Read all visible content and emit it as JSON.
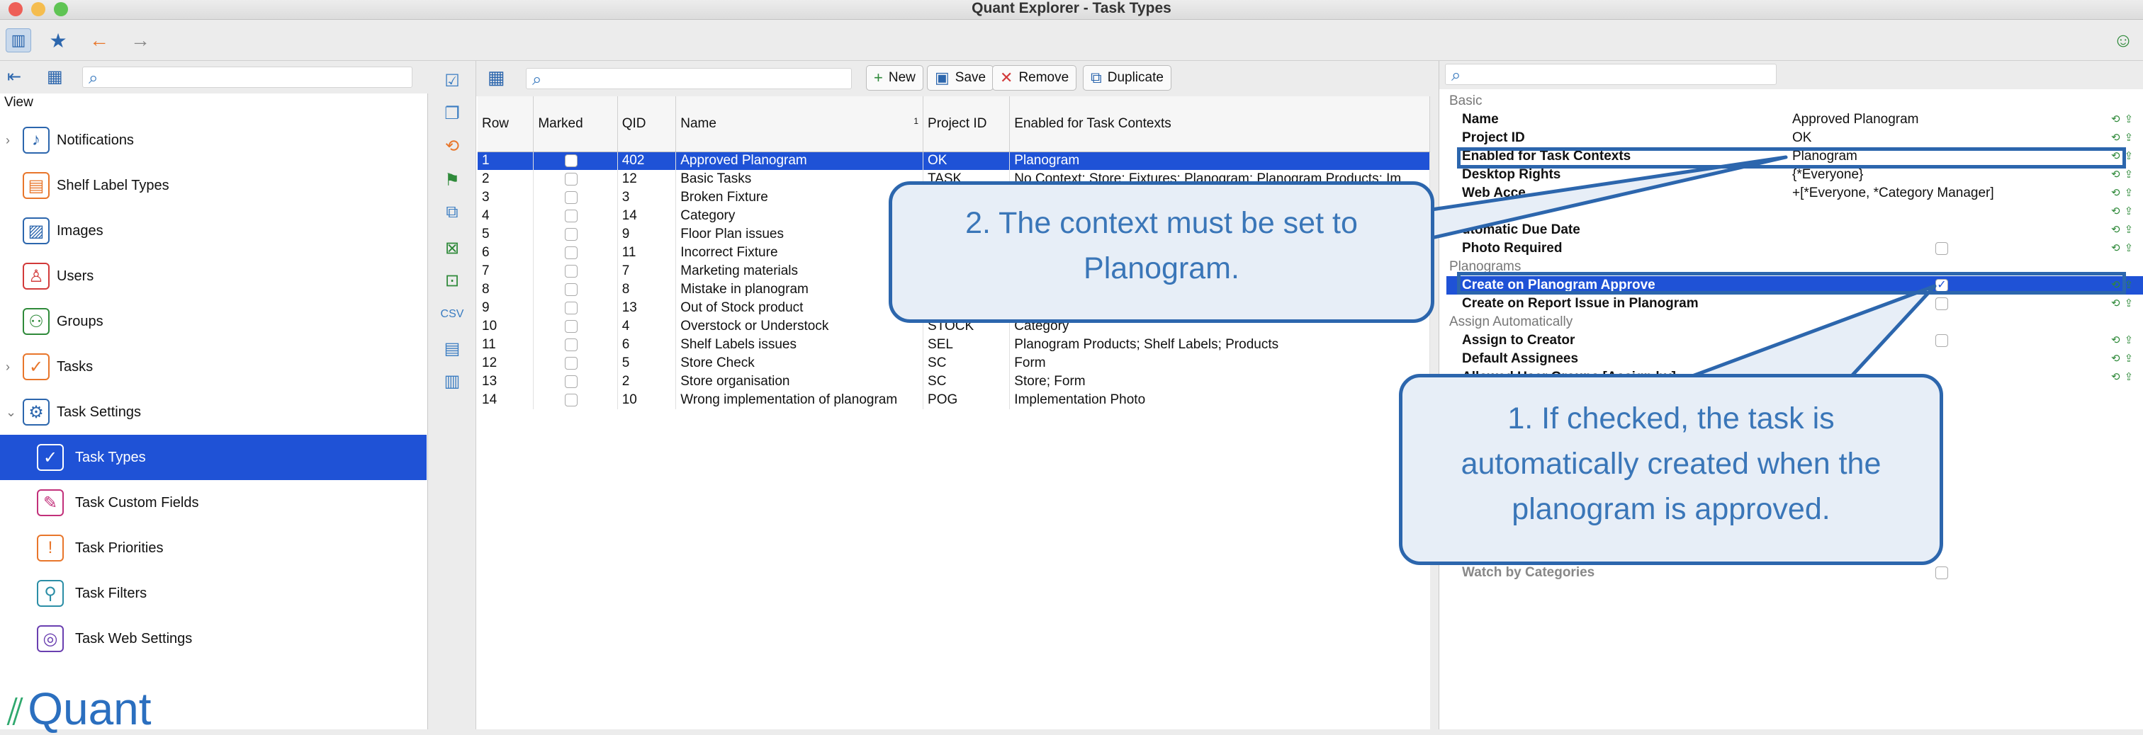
{
  "window": {
    "title": "Quant Explorer - Task Types"
  },
  "toolbar": {
    "icons": [
      "sidebar-toggle-icon",
      "star-icon",
      "back-arrow-icon",
      "forward-arrow-icon",
      "smiley-icon"
    ]
  },
  "left": {
    "view_label": "View",
    "nav": [
      {
        "label": "Notifications",
        "icon": "bell-icon",
        "expandable": true,
        "color": "#2c66ad"
      },
      {
        "label": "Shelf Label Types",
        "icon": "shelf-label-icon",
        "expandable": false,
        "color": "#e8762b"
      },
      {
        "label": "Images",
        "icon": "image-icon",
        "expandable": false,
        "color": "#2c66ad"
      },
      {
        "label": "Users",
        "icon": "user-icon",
        "expandable": false,
        "color": "#d23a3a"
      },
      {
        "label": "Groups",
        "icon": "group-icon",
        "expandable": false,
        "color": "#2f8a3a"
      },
      {
        "label": "Tasks",
        "icon": "task-check-icon",
        "expandable": true,
        "color": "#e8762b"
      },
      {
        "label": "Task Settings",
        "icon": "task-settings-icon",
        "expandable": true,
        "color": "#2c66ad"
      },
      {
        "label": "Task Types",
        "icon": "task-types-icon",
        "expandable": false,
        "color": "#2f8a3a",
        "selected": true
      },
      {
        "label": "Task Custom Fields",
        "icon": "task-custom-fields-icon",
        "expandable": false,
        "color": "#c2307a"
      },
      {
        "label": "Task Priorities",
        "icon": "task-priorities-icon",
        "expandable": false,
        "color": "#e8762b"
      },
      {
        "label": "Task Filters",
        "icon": "task-filters-icon",
        "expandable": false,
        "color": "#2b8ea6"
      },
      {
        "label": "Task Web Settings",
        "icon": "task-web-settings-icon",
        "expandable": false,
        "color": "#6a3fb0"
      }
    ],
    "logo_text": "Quant"
  },
  "grid": {
    "buttons": {
      "new": "New",
      "save": "Save",
      "remove": "Remove",
      "duplicate": "Duplicate"
    },
    "columns": [
      "Row",
      "Marked",
      "QID",
      "Name",
      "Project ID",
      "Enabled for Task Contexts"
    ],
    "sort_indicator": "1",
    "rows": [
      {
        "row": "1",
        "qid": "402",
        "name": "Approved Planogram",
        "project": "OK",
        "contexts": "Planogram",
        "selected": true
      },
      {
        "row": "2",
        "qid": "12",
        "name": "Basic Tasks",
        "project": "TASK",
        "contexts": "No Context; Store; Fixtures; Planogram; Planogram Products; Im"
      },
      {
        "row": "3",
        "qid": "3",
        "name": "Broken Fixture",
        "project": "",
        "contexts": ""
      },
      {
        "row": "4",
        "qid": "14",
        "name": "Category",
        "project": "",
        "contexts": ""
      },
      {
        "row": "5",
        "qid": "9",
        "name": "Floor Plan issues",
        "project": "",
        "contexts": ""
      },
      {
        "row": "6",
        "qid": "11",
        "name": "Incorrect Fixture",
        "project": "",
        "contexts": ""
      },
      {
        "row": "7",
        "qid": "7",
        "name": "Marketing materials",
        "project": "",
        "contexts": ""
      },
      {
        "row": "8",
        "qid": "8",
        "name": "Mistake in planogram",
        "project": "",
        "contexts": ""
      },
      {
        "row": "9",
        "qid": "13",
        "name": "Out of Stock product",
        "project": "",
        "contexts": ""
      },
      {
        "row": "10",
        "qid": "4",
        "name": "Overstock or Understock",
        "project": "STOCK",
        "contexts": "Category"
      },
      {
        "row": "11",
        "qid": "6",
        "name": "Shelf Labels issues",
        "project": "SEL",
        "contexts": "Planogram Products; Shelf Labels; Products"
      },
      {
        "row": "12",
        "qid": "5",
        "name": "Store Check",
        "project": "SC",
        "contexts": "Form"
      },
      {
        "row": "13",
        "qid": "2",
        "name": "Store organisation",
        "project": "SC",
        "contexts": "Store; Form"
      },
      {
        "row": "14",
        "qid": "10",
        "name": "Wrong implementation of planogram",
        "project": "POG",
        "contexts": "Implementation Photo"
      }
    ]
  },
  "props": {
    "rows": [
      {
        "type": "cat",
        "name": "Basic"
      },
      {
        "type": "prop",
        "name": "Name",
        "value": "Approved Planogram"
      },
      {
        "type": "prop",
        "name": "Project ID",
        "value": "OK"
      },
      {
        "type": "prop",
        "name": "Enabled for Task Contexts",
        "value": "Planogram"
      },
      {
        "type": "prop",
        "name": "Desktop Rights",
        "value": "{*Everyone}"
      },
      {
        "type": "prop",
        "name": "Web Acce",
        "value": "+[*Everyone, *Category Manager]"
      },
      {
        "type": "prop",
        "name": "",
        "value": ""
      },
      {
        "type": "prop",
        "name": "utomatic Due Date",
        "value": ""
      },
      {
        "type": "check",
        "name": "Photo Required",
        "checked": false
      },
      {
        "type": "cat",
        "name": "Planograms"
      },
      {
        "type": "check",
        "name": "Create on Planogram Approve",
        "checked": true,
        "selected": true
      },
      {
        "type": "check",
        "name": "Create on Report Issue in Planogram",
        "checked": false
      },
      {
        "type": "cat",
        "name": "Assign Automatically"
      },
      {
        "type": "check",
        "name": "Assign to Creator",
        "checked": false
      },
      {
        "type": "prop",
        "name": "Default Assignees",
        "value": ""
      },
      {
        "type": "prop",
        "name": "Allowed User Groups [Assign by]",
        "value": ""
      }
    ],
    "watch_label": "Watch by Categories"
  },
  "callouts": {
    "context": "2. The context must be set to Planogram.",
    "approve": "1. If checked, the task is automatically created when the planogram is approved."
  },
  "colors": {
    "selection": "#1f52d6",
    "callout_border": "#2c66ad",
    "callout_fill": "#e7eef7"
  }
}
